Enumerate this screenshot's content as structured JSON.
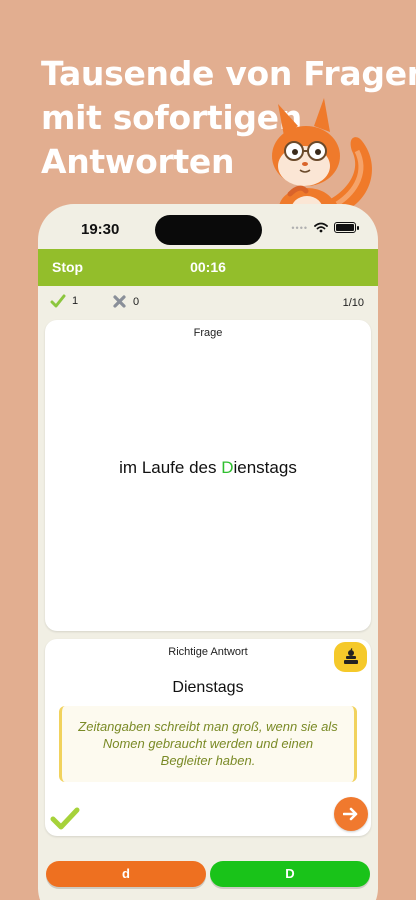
{
  "promo": {
    "headline_lines": [
      "Tausende von Fragen",
      "mit sofortigen",
      "Antworten"
    ]
  },
  "status_bar": {
    "time": "19:30"
  },
  "quiz": {
    "stop_label": "Stop",
    "timer": "00:16",
    "correct_count": "1",
    "wrong_count": "0",
    "progress": "1/10"
  },
  "question_card": {
    "label": "Frage",
    "text_before": "im Laufe des ",
    "text_highlight": "D",
    "text_after": "ienstags"
  },
  "answer_card": {
    "label": "Richtige Antwort",
    "answer": "Dienstags",
    "explanation": "Zeitangaben schreibt man groß, wenn sie als Nomen gebraucht werden und einen Begleiter haben."
  },
  "choices": {
    "left": "d",
    "right": "D"
  },
  "icons": {
    "correct": "checkmark-icon",
    "wrong": "cross-icon",
    "book": "book-stack-icon",
    "next": "arrow-right-icon",
    "mascot": "squirrel-mascot"
  },
  "colors": {
    "background": "#e2ae90",
    "topbar": "#93be2b",
    "highlight": "#2fbf2f",
    "choice_left": "#ee7020",
    "choice_right": "#19c319",
    "next_button": "#f0792e",
    "book_button": "#f5c92a"
  }
}
